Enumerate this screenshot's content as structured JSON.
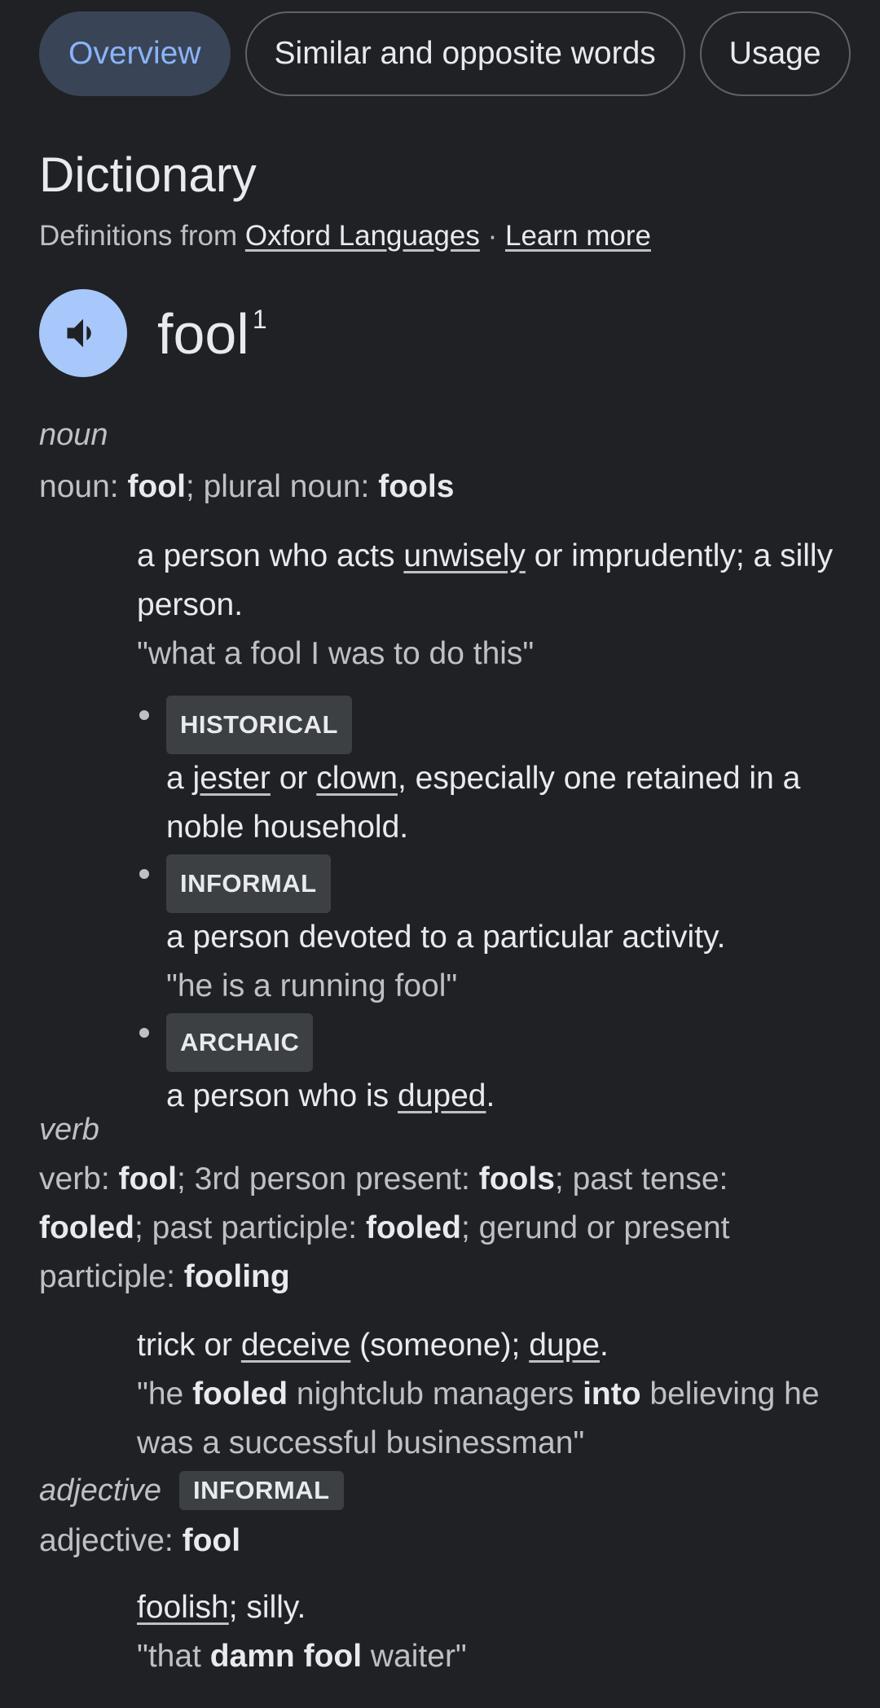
{
  "tabs": [
    {
      "label": "Overview",
      "active": true
    },
    {
      "label": "Similar and opposite words",
      "active": false
    },
    {
      "label": "Usage",
      "active": false
    }
  ],
  "heading": {
    "title": "Dictionary",
    "source_prefix": "Definitions from",
    "source_link": "Oxford Languages",
    "separator": "·",
    "learn_more": "Learn more"
  },
  "entry": {
    "word": "fool",
    "superscript": "1",
    "speaker_icon": "volume-icon"
  },
  "noun": {
    "pos": "noun",
    "forms": {
      "label1": "noun: ",
      "word1": "fool",
      "sep": "; plural noun: ",
      "word2": "fools"
    },
    "def1": {
      "pre": "a person who acts ",
      "link": "unwisely",
      "post": " or imprudently; a silly person.",
      "example": "\"what a fool I was to do this\""
    },
    "senses": [
      {
        "tag": "HISTORICAL",
        "pre": "a ",
        "link1": "jester",
        "mid": " or ",
        "link2": "clown",
        "post": ", especially one retained in a noble household."
      },
      {
        "tag": "INFORMAL",
        "text": "a person devoted to a particular activity.",
        "example": "\"he is a running fool\""
      },
      {
        "tag": "ARCHAIC",
        "pre": "a person who is ",
        "link": "duped",
        "post": "."
      }
    ]
  },
  "verb": {
    "pos": "verb",
    "forms": {
      "l1": "verb: ",
      "w1": "fool",
      "l2": "; 3rd person present: ",
      "w2": "fools",
      "l3": "; past tense: ",
      "w3": "fooled",
      "l4": "; past participle: ",
      "w4": "fooled",
      "l5": "; gerund or present participle: ",
      "w5": "fooling"
    },
    "def": {
      "pre": "trick or ",
      "link1": "deceive",
      "mid": " (someone); ",
      "link2": "dupe",
      "post": ".",
      "ex_pre": "\"he ",
      "ex_b1": "fooled",
      "ex_mid": " nightclub managers ",
      "ex_b2": "into",
      "ex_post": " believing he was a successful businessman\""
    }
  },
  "adjective": {
    "pos": "adjective",
    "tag": "INFORMAL",
    "forms": {
      "label": "adjective: ",
      "word": "fool"
    },
    "def": {
      "link": "foolish",
      "post": "; silly.",
      "ex_pre": "\"that ",
      "ex_b": "damn fool",
      "ex_post": " waiter\""
    }
  }
}
